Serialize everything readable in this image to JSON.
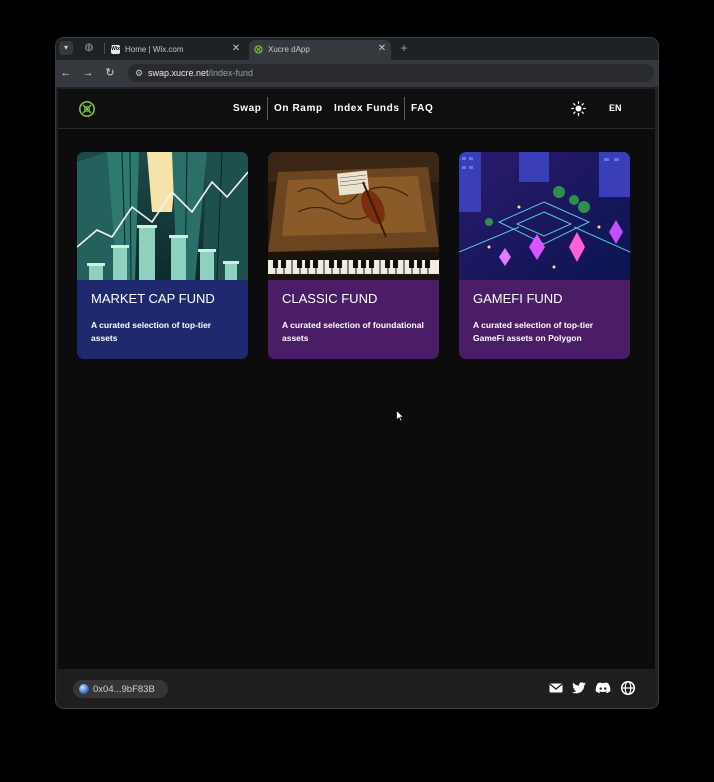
{
  "browser": {
    "tabs": [
      {
        "title": "Home | Wix.com",
        "favicon_label": "Wix",
        "active": false
      },
      {
        "title": "Xucre dApp",
        "active": true
      }
    ],
    "omnibox": {
      "host": "swap.xucre.net",
      "path": "/index-fund"
    }
  },
  "header": {
    "nav": [
      {
        "label": "Swap"
      },
      {
        "label": "On Ramp"
      },
      {
        "label": "Index Funds"
      },
      {
        "label": "FAQ"
      }
    ],
    "language": "EN"
  },
  "cards": [
    {
      "title": "MARKET CAP FUND",
      "description": "A curated selection of top-tier assets",
      "color": "#1f2a6e"
    },
    {
      "title": "CLASSIC FUND",
      "description": "A curated selection of foundational assets",
      "color": "#4a1d66"
    },
    {
      "title": "GAMEFI FUND",
      "description": "A curated selection of top-tier GameFi assets on Polygon",
      "color": "#4a1d66"
    }
  ],
  "footer": {
    "wallet_address": "0x04...9bF83B"
  },
  "colors": {
    "accent_green": "#7fbf3f",
    "page_bg": "#0c0c0c",
    "footer_bg": "#1e1e1e"
  }
}
